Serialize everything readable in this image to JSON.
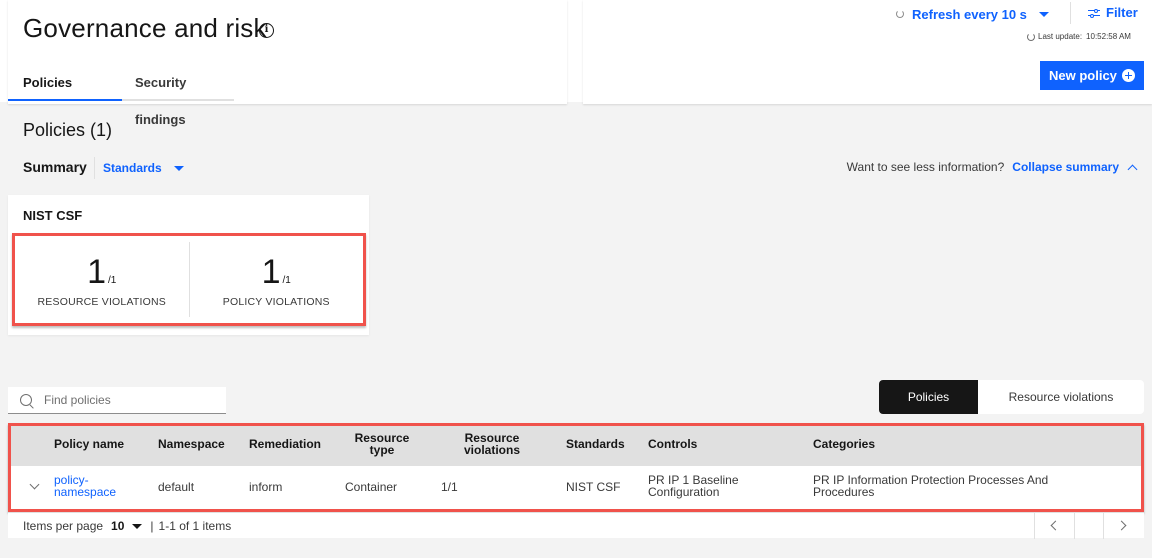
{
  "header": {
    "title": "Governance and risk",
    "info_icon": "info-icon",
    "tabs": [
      {
        "label": "Policies",
        "active": true
      },
      {
        "label": "Security findings",
        "active": false
      }
    ],
    "refresh": {
      "label": "Refresh every 10 s",
      "icon": "spinner-icon"
    },
    "filter": {
      "label": "Filter",
      "icon": "sliders-icon"
    },
    "last_update": {
      "label": "Last update:",
      "time": "10:52:58 AM"
    },
    "new_policy": {
      "label": "New policy",
      "icon": "plus-circle-icon"
    }
  },
  "overview": {
    "policies_count": "Policies (1)",
    "summary_label": "Summary",
    "summary_dropdown": "Standards",
    "collapse_question": "Want to see less information?",
    "collapse_link": "Collapse summary"
  },
  "summary_card": {
    "title": "NIST CSF",
    "stats": [
      {
        "value": "1",
        "total": "/1",
        "label": "RESOURCE VIOLATIONS"
      },
      {
        "value": "1",
        "total": "/1",
        "label": "POLICY VIOLATIONS"
      }
    ]
  },
  "search": {
    "placeholder": "Find policies",
    "value": ""
  },
  "view_toggle": {
    "options": [
      {
        "label": "Policies",
        "selected": true
      },
      {
        "label": "Resource violations",
        "selected": false
      }
    ]
  },
  "table": {
    "columns": [
      "Policy name",
      "Namespace",
      "Remediation",
      "Resource type",
      "Resource violations",
      "Standards",
      "Controls",
      "Categories"
    ],
    "rows": [
      {
        "policy_name": "policy-namespace",
        "namespace": "default",
        "remediation": "inform",
        "resource_type": "Container",
        "resource_violations": "1/1",
        "standards": "NIST CSF",
        "controls": "PR IP 1 Baseline Configuration",
        "categories": "PR IP Information Protection Processes And Procedures"
      }
    ]
  },
  "pagination": {
    "items_per_page_label": "Items per page",
    "items_per_page": "10",
    "separator": "|",
    "range": "1-1 of 1 items"
  },
  "colors": {
    "accent": "#0f62fe",
    "highlight_border": "#f0524b",
    "toggle_selected_bg": "#161616"
  }
}
